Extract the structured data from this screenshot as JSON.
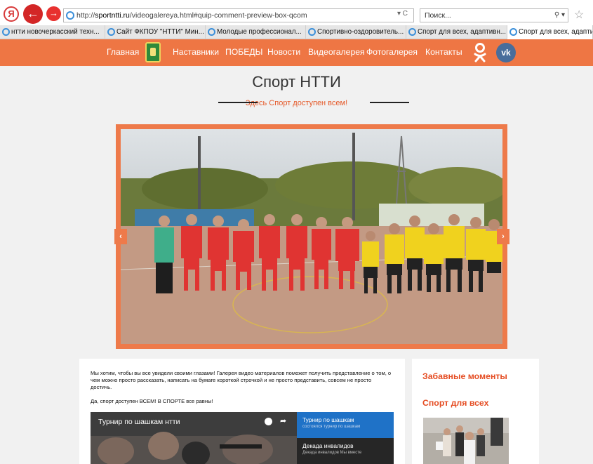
{
  "browser": {
    "url_prefix": "http://",
    "url_host": "sportntti.ru",
    "url_path": "/videogalereya.html#quip-comment-preview-box-qcom",
    "url_tools": "▾ C",
    "search_placeholder": "Поиск...",
    "search_tools": "⚲ ▾",
    "tabs": [
      {
        "label": "нтти новочеркасский техн...",
        "active": false
      },
      {
        "label": "Сайт ФКПОУ \"НТТИ\" Мин...",
        "active": false
      },
      {
        "label": "Молодые профессионал...",
        "active": false
      },
      {
        "label": "Спортивно-оздоровитель...",
        "active": false
      },
      {
        "label": "Спорт для всех, адаптивн...",
        "active": false
      },
      {
        "label": "Спорт для всех, адапти...",
        "active": true
      }
    ]
  },
  "nav": {
    "items": [
      "Главная",
      "Наставники",
      "ПОБЕДЫ",
      "Новости",
      "Видеогалерея",
      "Фотогалерея",
      "Контакты"
    ],
    "vk_label": "vk"
  },
  "hero": {
    "title": "Спорт НТТИ",
    "subtitle": "Здесь Спорт доступен всем!"
  },
  "slider": {
    "prev_label": "‹",
    "next_label": "›"
  },
  "content": {
    "intro": "Мы хотим, чтобы вы все увидели своими глазами! Галерея видео материалов поможет получить представление о том, о чем можно просто рассказать, написать на бумаге короткой строчкой и не просто представить, совсем не просто достичь.",
    "intro2": "Да, спорт доступен ВСЕМ! В СПОРТЕ все равны!",
    "video_title": "Турнир по шашкам нтти",
    "playlist": [
      {
        "title": "Турнир по шашкам",
        "subtitle": "состоялся турнир по шашкам"
      },
      {
        "title": "Декада инвалидов",
        "subtitle": "Декада инвалидов Мы вместе"
      }
    ]
  },
  "sidebar": {
    "heading1": "Забавные моменты",
    "heading2": "Спорт для всех"
  },
  "colors": {
    "brand_orange": "#ee7644",
    "accent_red": "#e54d23",
    "playlist_blue": "#1f72c7"
  }
}
